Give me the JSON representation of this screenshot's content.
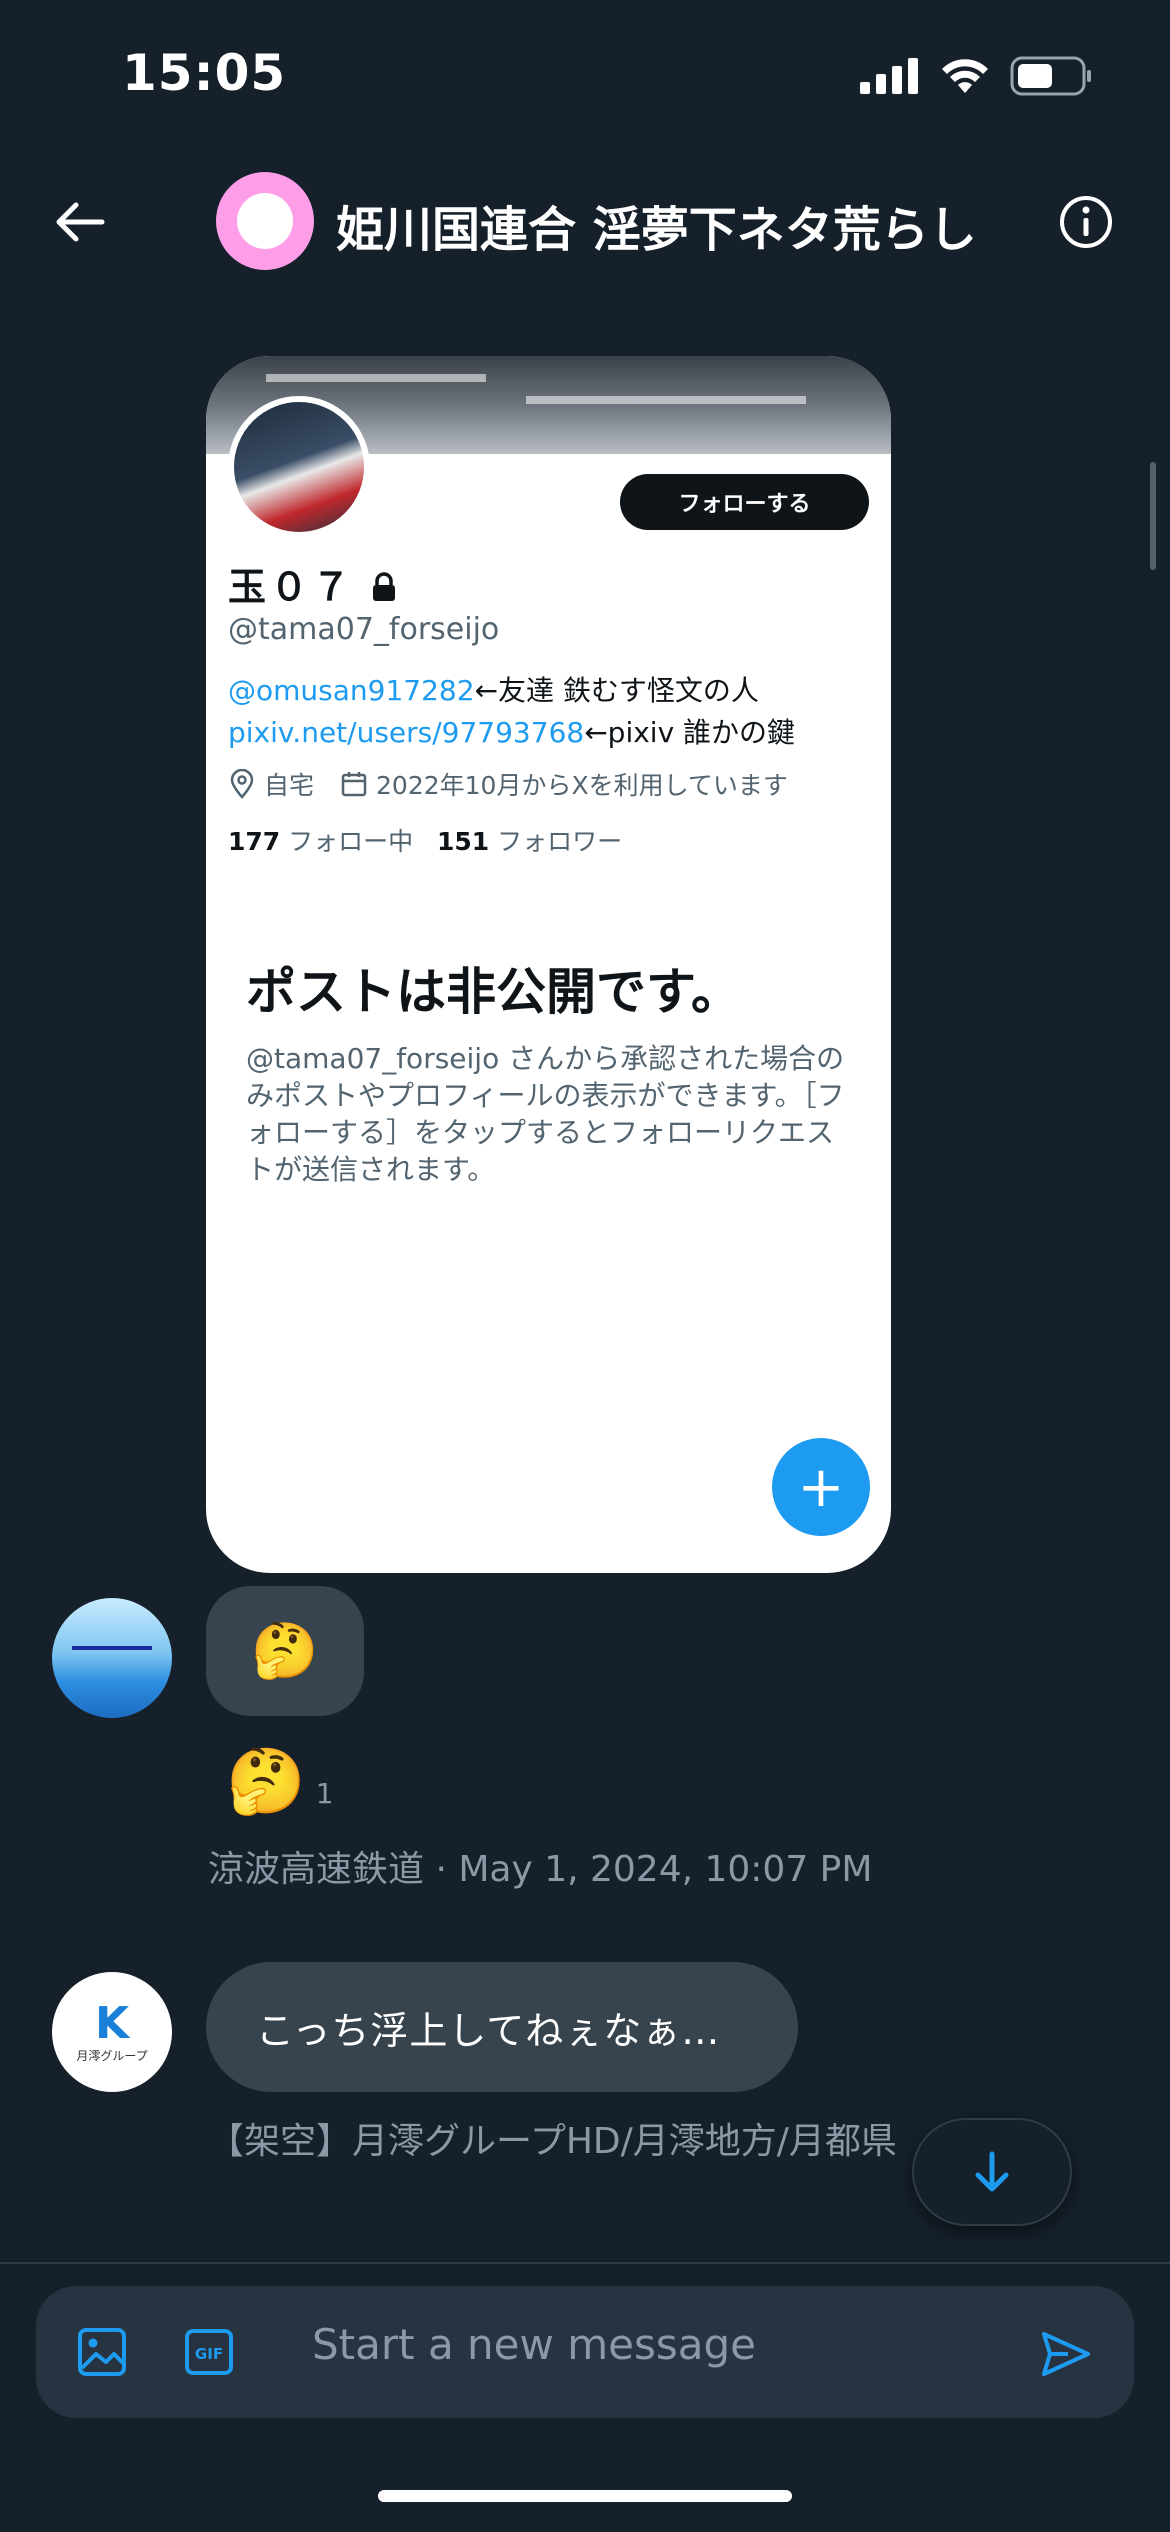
{
  "status_bar": {
    "time": "15:05"
  },
  "header": {
    "title": "姫川国連合 淫夢下ネタ荒らし"
  },
  "shared_card": {
    "follow_label": "フォローする",
    "name": "玉０７",
    "handle": "@tama07_forseijo",
    "bio_line1_link": "@omusan917282",
    "bio_line1_text": "←友達 鉄むす怪文の人",
    "bio_line2_link": "pixiv.net/users/97793768",
    "bio_line2_text": "←pixiv 誰かの鍵",
    "location": "自宅",
    "joined": "2022年10月からXを利用しています",
    "following_count": "177",
    "following_label": "フォロー中",
    "followers_count": "151",
    "followers_label": "フォロワー",
    "private_title": "ポストは非公開です。",
    "private_body": "@tama07_forseijo さんから承認された場合のみポストやプロフィールの表示ができます。［フォローする］をタップするとフォローリクエストが送信されます。",
    "fab_label": "+"
  },
  "messages": [
    {
      "content": "🤔",
      "reaction_emoji": "🤔",
      "reaction_count": "1",
      "meta": "涼波高速鉄道 · May 1, 2024, 10:07 PM"
    },
    {
      "avatar_logo": "K",
      "avatar_sub": "月澪グループ",
      "content": "こっち浮上してねぇなぁ…",
      "meta": "【架空】月澪グループHD/月澪地方/月都県"
    }
  ],
  "composer": {
    "placeholder": "Start a new message"
  },
  "icons": {
    "back": "arrow-left-icon",
    "info": "info-icon",
    "image": "image-icon",
    "gif": "gif-icon",
    "send": "send-icon",
    "scroll": "arrow-down-icon"
  },
  "colors": {
    "accent": "#1d9bf0",
    "background": "#15202b",
    "bubble": "#38444d",
    "avatar_pink": "#ff9ee8"
  }
}
